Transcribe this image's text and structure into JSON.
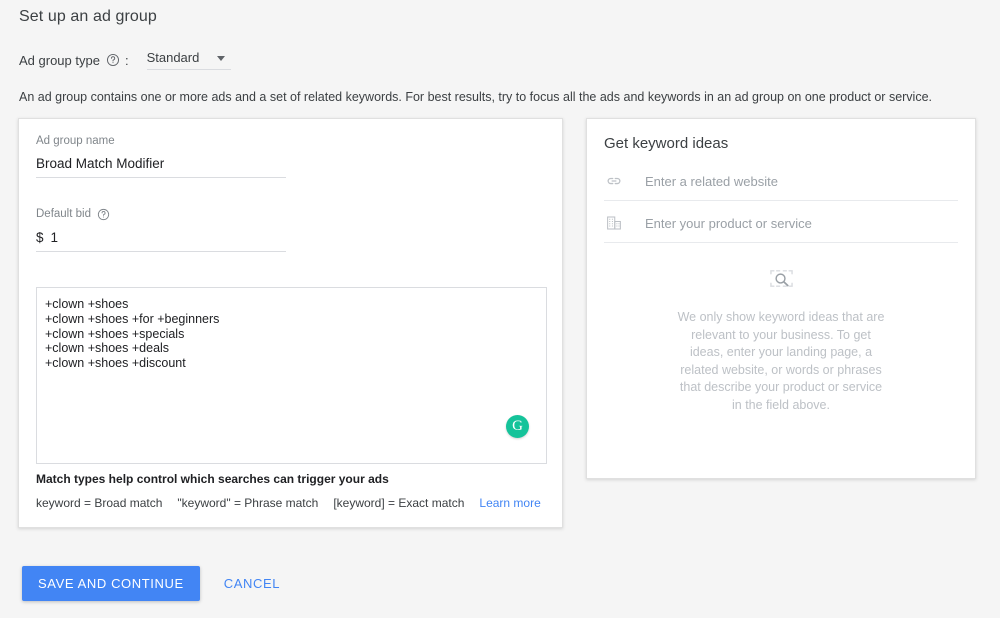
{
  "header": {
    "title": "Set up an ad group",
    "type_label": "Ad group type",
    "help_icon": "help-circle-icon",
    "colon": ":",
    "selected_type": "Standard",
    "type_options": [
      "Standard"
    ],
    "caret_icon": "chevron-down-icon",
    "intro": "An ad group contains one or more ads and a set of related keywords. For best results, try to focus all the ads and keywords in an ad group on one product or service."
  },
  "ad_group_card": {
    "name_field": {
      "label": "Ad group name",
      "value": "Broad Match Modifier"
    },
    "bid_field": {
      "label": "Default bid",
      "help_icon": "help-circle-icon",
      "currency": "$",
      "value": "1"
    },
    "keywords": {
      "lines": [
        "+clown +shoes",
        "+clown +shoes +for +beginners",
        "+clown +shoes +specials",
        "+clown +shoes +deals",
        "+clown +shoes +discount"
      ]
    },
    "grammarly": {
      "icon": "grammarly-icon",
      "glyph": "G",
      "color": "#15c39a"
    },
    "match_help": {
      "title": "Match types help control which searches can trigger your ads",
      "broad": "keyword = Broad match",
      "phrase": "\"keyword\" = Phrase match",
      "exact": "[keyword] = Exact match",
      "learn_more": "Learn more",
      "link_color": "#4285f4"
    }
  },
  "keyword_ideas_card": {
    "title": "Get keyword ideas",
    "website_input": {
      "icon": "link-icon",
      "placeholder": "Enter a related website",
      "value": ""
    },
    "product_input": {
      "icon": "business-building-icon",
      "placeholder": "Enter your product or service",
      "value": ""
    },
    "empty_state": {
      "icon": "search-frame-icon",
      "text": "We only show keyword ideas that are relevant to your business. To get ideas, enter your landing page, a related website, or words or phrases that describe your product or service in the field above."
    }
  },
  "footer": {
    "save_label": "SAVE AND CONTINUE",
    "cancel_label": "CANCEL",
    "primary_color": "#4285f4"
  }
}
